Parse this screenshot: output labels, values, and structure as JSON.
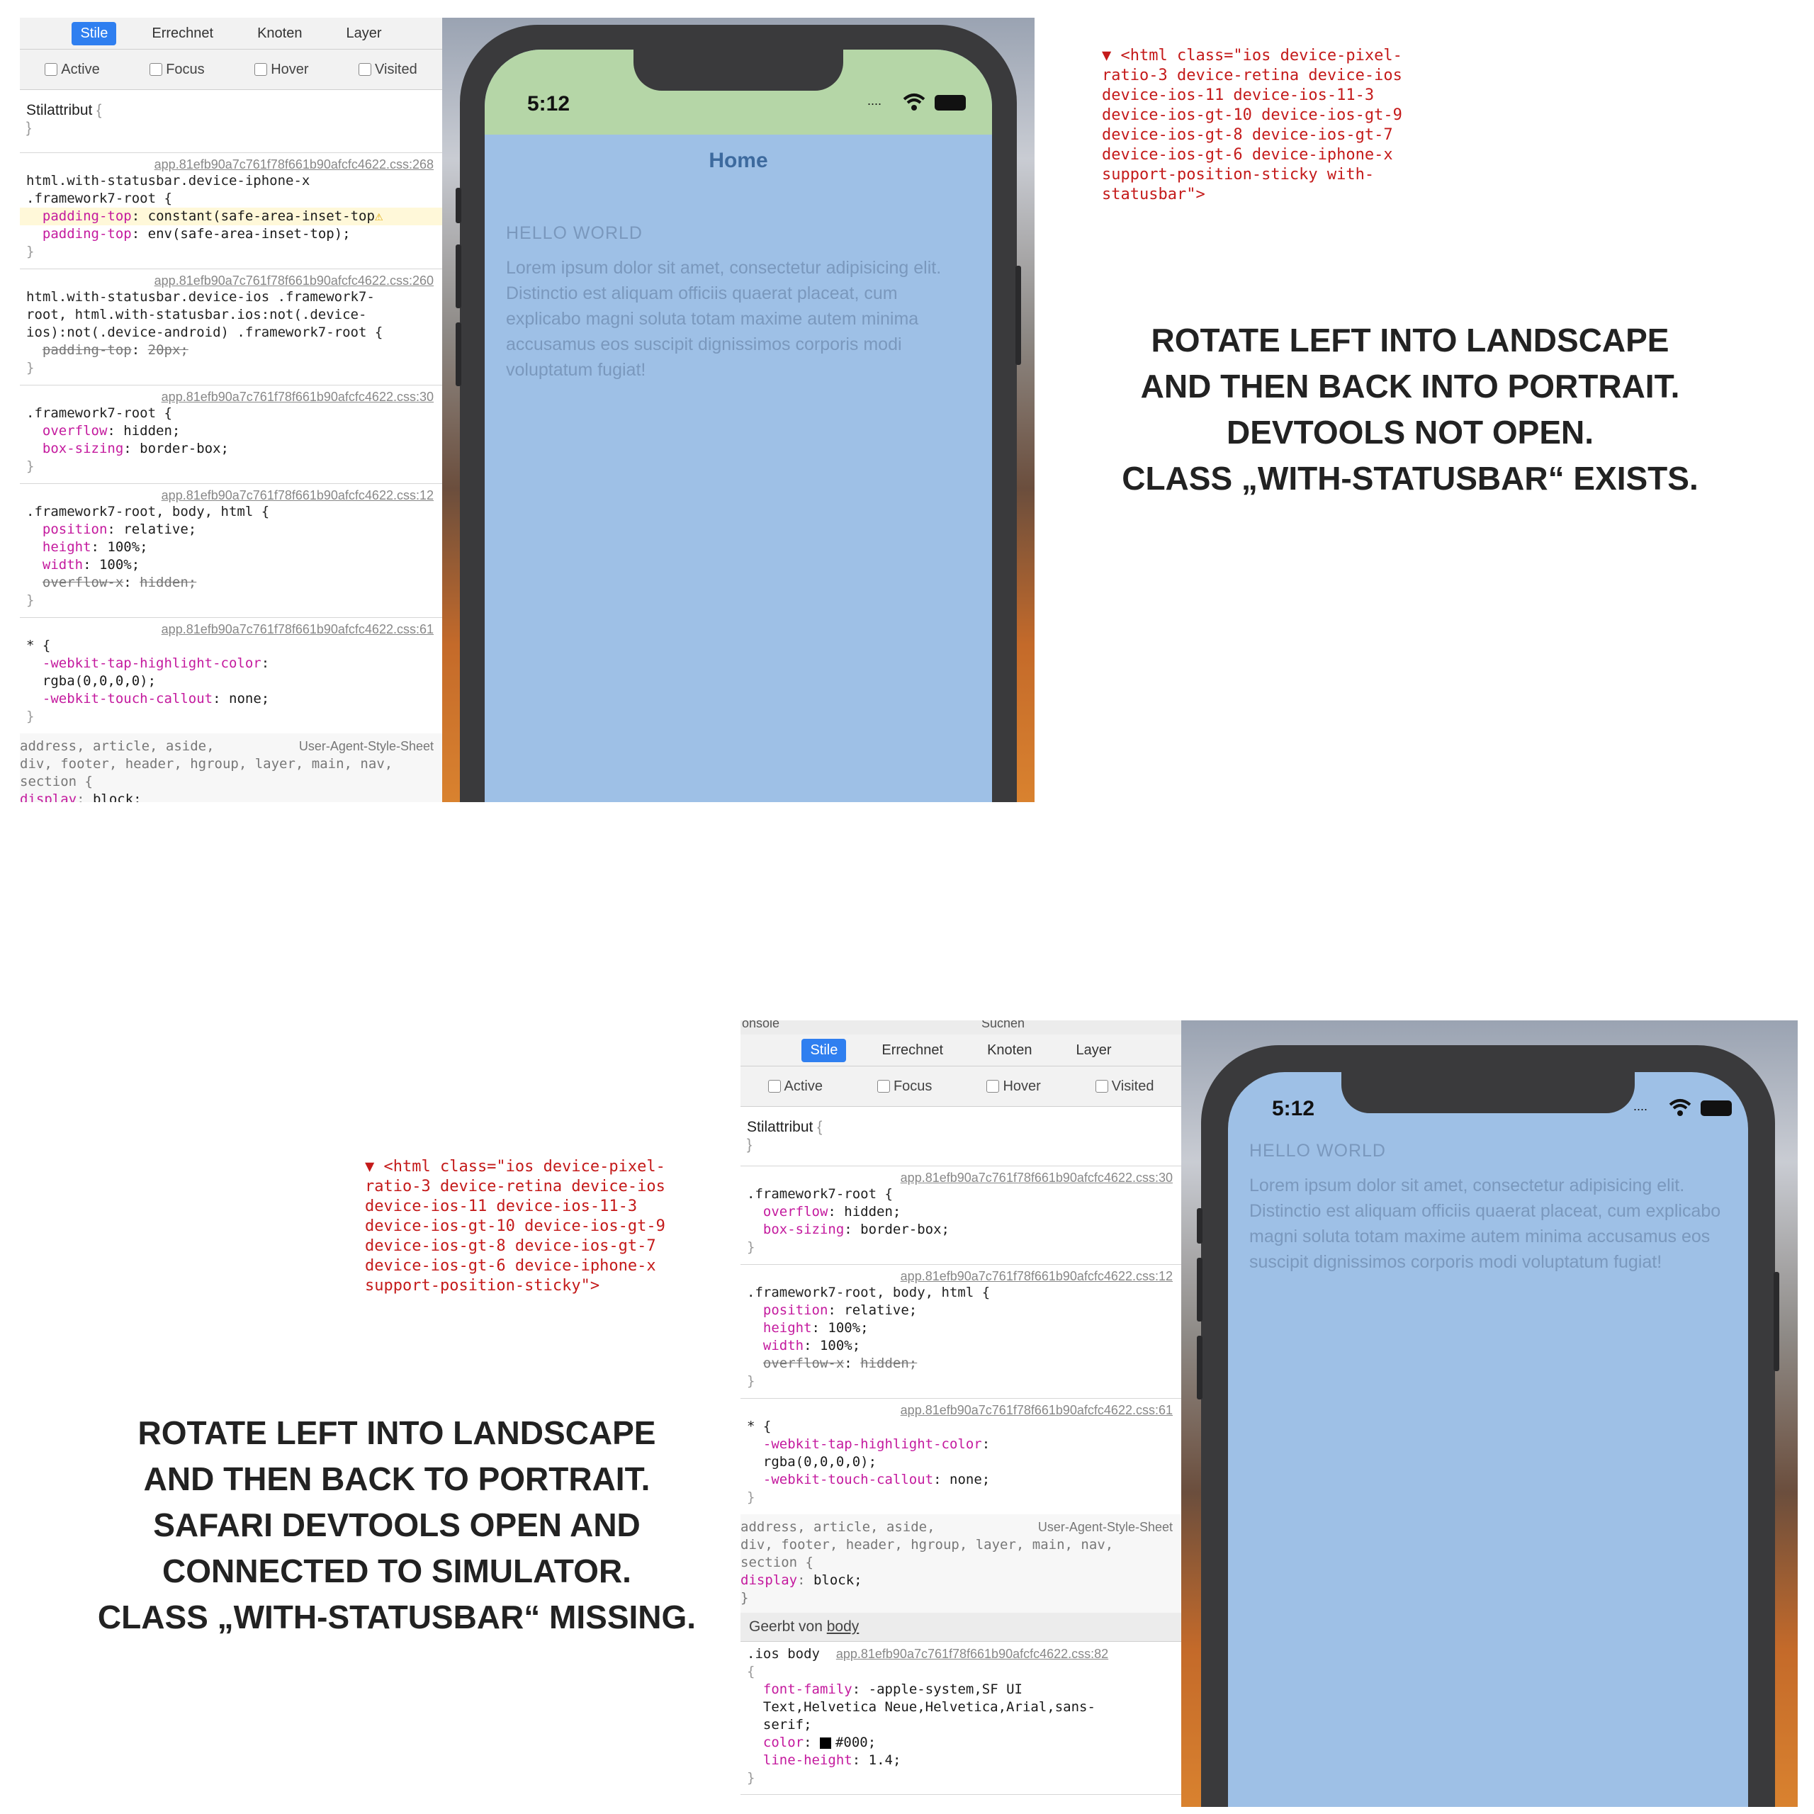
{
  "top": {
    "devtools": {
      "tabs": [
        "Stile",
        "Errechnet",
        "Knoten",
        "Layer"
      ],
      "active_tab": "Stile",
      "pseudo": [
        "Active",
        "Focus",
        "Hover",
        "Visited"
      ],
      "style_attr_label": "Stilattribut",
      "brace_open": "{",
      "brace_close": "}",
      "rules": [
        {
          "source": "app.81efb90a7c761f78f661b90afcfc4622.css:268",
          "selector_lines": [
            "html.with-statusbar.device-iphone-x",
            ".framework7-root {"
          ],
          "decls": [
            {
              "prop": "padding-top",
              "val": "constant(safe-area-inset-top",
              "warn": true,
              "strike": false
            },
            {
              "prop": "padding-top",
              "val": "env(safe-area-inset-top);",
              "warn": false,
              "strike": false
            }
          ]
        },
        {
          "source": "app.81efb90a7c761f78f661b90afcfc4622.css:260",
          "selector_lines": [
            "html.with-statusbar.device-ios .framework7-",
            "root, html.with-statusbar.ios:not(.device-",
            "ios):not(.device-android) .framework7-root {"
          ],
          "decls": [
            {
              "prop": "padding-top",
              "val": "20px;",
              "warn": false,
              "strike": true
            }
          ]
        },
        {
          "source": "app.81efb90a7c761f78f661b90afcfc4622.css:30",
          "selector_lines": [
            ".framework7-root {"
          ],
          "decls": [
            {
              "prop": "overflow",
              "val": "hidden;",
              "warn": false,
              "strike": false
            },
            {
              "prop": "box-sizing",
              "val": "border-box;",
              "warn": false,
              "strike": false
            }
          ]
        },
        {
          "source": "app.81efb90a7c761f78f661b90afcfc4622.css:12",
          "selector_lines": [
            ".framework7-root, body, html {"
          ],
          "decls": [
            {
              "prop": "position",
              "val": "relative;",
              "warn": false,
              "strike": false
            },
            {
              "prop": "height",
              "val": "100%;",
              "warn": false,
              "strike": false
            },
            {
              "prop": "width",
              "val": "100%;",
              "warn": false,
              "strike": false
            },
            {
              "prop": "overflow-x",
              "val": "hidden;",
              "warn": false,
              "strike": true
            }
          ]
        },
        {
          "source": "app.81efb90a7c761f78f661b90afcfc4622.css:61",
          "selector_lines": [
            "* {"
          ],
          "decls": [
            {
              "prop": "-webkit-tap-highlight-color",
              "val": "",
              "warn": false,
              "strike": false
            },
            {
              "prop": "",
              "val": "rgba(0,0,0,0);",
              "warn": false,
              "strike": false
            },
            {
              "prop": "-webkit-touch-callout",
              "val": "none;",
              "warn": false,
              "strike": false
            }
          ]
        }
      ],
      "ua_rule": {
        "source": "User-Agent-Style-Sheet",
        "selector_lines": [
          "address, article, aside,",
          "div, footer, header, hgroup, layer, main, nav,",
          "section {"
        ],
        "decls": [
          {
            "prop": "display",
            "val": "block;"
          }
        ]
      }
    },
    "phone": {
      "time": "5:12",
      "nav_title": "Home",
      "heading": "HELLO WORLD",
      "body": "Lorem ipsum dolor sit amet, consectetur adipisicing elit. Distinctio est aliquam officiis quaerat placeat, cum explicabo magni soluta totam maxime autem minima accusamus eos suscipit dignissimos corporis modi voluptatum fugiat!",
      "statusbar_color": "#b5d6a7"
    },
    "html_class": "▼ <html class=\"ios device-pixel-\nratio-3 device-retina device-ios\ndevice-ios-11 device-ios-11-3\ndevice-ios-gt-10 device-ios-gt-9\ndevice-ios-gt-8 device-ios-gt-7\ndevice-ios-gt-6 device-iphone-x\nsupport-position-sticky with-\nstatusbar\">",
    "caption": [
      "ROTATE LEFT INTO LANDSCAPE",
      "AND THEN BACK INTO  PORTRAIT.",
      "DEVTOOLS NOT OPEN.",
      "CLASS „WITH-STATUSBAR“ EXISTS."
    ]
  },
  "bottom": {
    "devtools": {
      "top_strip": [
        "onsole",
        "Suchen"
      ],
      "tabs": [
        "Stile",
        "Errechnet",
        "Knoten",
        "Layer"
      ],
      "active_tab": "Stile",
      "pseudo": [
        "Active",
        "Focus",
        "Hover",
        "Visited"
      ],
      "style_attr_label": "Stilattribut",
      "rules": [
        {
          "source": "app.81efb90a7c761f78f661b90afcfc4622.css:30",
          "selector_lines": [
            ".framework7-root {"
          ],
          "decls": [
            {
              "prop": "overflow",
              "val": "hidden;",
              "strike": false
            },
            {
              "prop": "box-sizing",
              "val": "border-box;",
              "strike": false
            }
          ]
        },
        {
          "source": "app.81efb90a7c761f78f661b90afcfc4622.css:12",
          "selector_lines": [
            ".framework7-root, body, html {"
          ],
          "decls": [
            {
              "prop": "position",
              "val": "relative;",
              "strike": false
            },
            {
              "prop": "height",
              "val": "100%;",
              "strike": false
            },
            {
              "prop": "width",
              "val": "100%;",
              "strike": false
            },
            {
              "prop": "overflow-x",
              "val": "hidden;",
              "strike": true
            }
          ]
        },
        {
          "source": "app.81efb90a7c761f78f661b90afcfc4622.css:61",
          "selector_lines": [
            "* {"
          ],
          "decls": [
            {
              "prop": "-webkit-tap-highlight-color",
              "val": "",
              "strike": false
            },
            {
              "prop": "",
              "val": "rgba(0,0,0,0);",
              "strike": false
            },
            {
              "prop": "-webkit-touch-callout",
              "val": "none;",
              "strike": false
            }
          ]
        }
      ],
      "ua_rule": {
        "source": "User-Agent-Style-Sheet",
        "selector_lines": [
          "address, article, aside,",
          "div, footer, header, hgroup, layer, main, nav,",
          "section {"
        ],
        "decls": [
          {
            "prop": "display",
            "val": "block;"
          }
        ]
      },
      "inherited_label": "Geerbt von",
      "inherited_link": "body",
      "body_rule": {
        "selector": ".ios body",
        "source": "app.81efb90a7c761f78f661b90afcfc4622.css:82",
        "decls": [
          {
            "prop": "font-family",
            "val": "-apple-system,SF UI"
          },
          {
            "prop": "",
            "val": "Text,Helvetica Neue,Helvetica,Arial,sans-"
          },
          {
            "prop": "",
            "val": "serif;"
          },
          {
            "prop": "color",
            "val": "#000;"
          },
          {
            "prop": "line-height",
            "val": "1.4;"
          }
        ]
      }
    },
    "phone": {
      "time": "5:12",
      "heading": "HELLO WORLD",
      "body": "Lorem ipsum dolor sit amet, consectetur adipisicing elit. Distinctio est aliquam officiis quaerat placeat, cum explicabo magni soluta totam maxime autem minima accusamus eos suscipit dignissimos corporis modi voluptatum fugiat!"
    },
    "html_class": "▼ <html class=\"ios device-pixel-\nratio-3 device-retina device-ios\ndevice-ios-11 device-ios-11-3\ndevice-ios-gt-10 device-ios-gt-9\ndevice-ios-gt-8 device-ios-gt-7\ndevice-ios-gt-6 device-iphone-x\nsupport-position-sticky\">",
    "caption": [
      "ROTATE LEFT INTO LANDSCAPE",
      "AND THEN BACK TO PORTRAIT.",
      "SAFARI DEVTOOLS OPEN AND",
      "CONNECTED TO SIMULATOR.",
      "CLASS „WITH-STATUSBAR“ MISSING."
    ]
  }
}
